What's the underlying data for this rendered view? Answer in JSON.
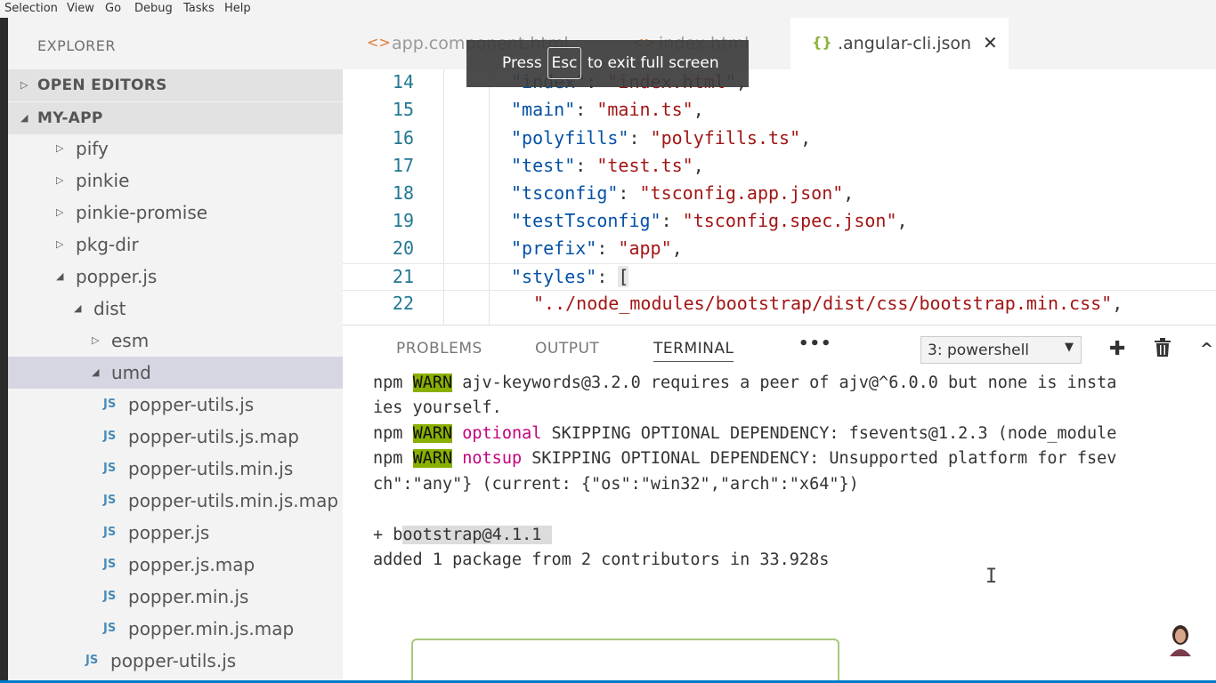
{
  "menubar": {
    "items": [
      "Selection",
      "View",
      "Go",
      "Debug",
      "Tasks",
      "Help"
    ]
  },
  "explorer": {
    "title": "EXPLORER",
    "open_editors": "OPEN EDITORS",
    "project": "MY-APP",
    "items": [
      {
        "name": "pify"
      },
      {
        "name": "pinkie"
      },
      {
        "name": "pinkie-promise"
      },
      {
        "name": "pkg-dir"
      },
      {
        "name": "popper.js"
      },
      {
        "name": "dist"
      },
      {
        "name": "esm"
      },
      {
        "name": "umd"
      },
      {
        "name": "popper-utils.js"
      },
      {
        "name": "popper-utils.js.map"
      },
      {
        "name": "popper-utils.min.js"
      },
      {
        "name": "popper-utils.min.js.map"
      },
      {
        "name": "popper.js"
      },
      {
        "name": "popper.js.map"
      },
      {
        "name": "popper.min.js"
      },
      {
        "name": "popper.min.js.map"
      },
      {
        "name": "popper-utils.js"
      }
    ],
    "js_badge": "JS"
  },
  "tabs": [
    {
      "icon": "<>",
      "label": "app.component.html"
    },
    {
      "icon": "<>",
      "label": "index.html"
    },
    {
      "icon": "{}",
      "label": ".angular-cli.json",
      "close": "✕"
    }
  ],
  "fullscreen_toast": {
    "press": "Press",
    "key": "Esc",
    "rest": "to exit full screen"
  },
  "code": {
    "lines": [
      {
        "num": "14",
        "key": "\"index\"",
        "sep": ": ",
        "value": "\"index.html\"",
        "end": ","
      },
      {
        "num": "15",
        "key": "\"main\"",
        "sep": ": ",
        "value": "\"main.ts\"",
        "end": ","
      },
      {
        "num": "16",
        "key": "\"polyfills\"",
        "sep": ": ",
        "value": "\"polyfills.ts\"",
        "end": ","
      },
      {
        "num": "17",
        "key": "\"test\"",
        "sep": ": ",
        "value": "\"test.ts\"",
        "end": ","
      },
      {
        "num": "18",
        "key": "\"tsconfig\"",
        "sep": ": ",
        "value": "\"tsconfig.app.json\"",
        "end": ","
      },
      {
        "num": "19",
        "key": "\"testTsconfig\"",
        "sep": ": ",
        "value": "\"tsconfig.spec.json\"",
        "end": ","
      },
      {
        "num": "20",
        "key": "\"prefix\"",
        "sep": ": ",
        "value": "\"app\"",
        "end": ","
      },
      {
        "num": "21",
        "key": "\"styles\"",
        "sep": ": ",
        "value": "",
        "end": "["
      },
      {
        "num": "22",
        "key": "",
        "sep": "",
        "value": "\"../node_modules/bootstrap/dist/css/bootstrap.min.css\"",
        "end": ","
      }
    ]
  },
  "panel": {
    "tabs": [
      "PROBLEMS",
      "OUTPUT",
      "TERMINAL"
    ],
    "more": "•••",
    "terminal_select": "3: powershell",
    "dropdown_arrow": "▼",
    "add": "✚",
    "trash": "🗑",
    "collapse": "^"
  },
  "terminal": {
    "l1_pre": "npm ",
    "warn": "WARN",
    "l1_post": " ajv-keywords@3.2.0 requires a peer of ajv@^6.0.0 but none is insta",
    "l2": "ies yourself.",
    "l3_tag": "optional",
    "l3_post": " SKIPPING OPTIONAL DEPENDENCY: fsevents@1.2.3 (node_module",
    "l4_tag": "notsup",
    "l4_post": " SKIPPING OPTIONAL DEPENDENCY: Unsupported platform for fsev",
    "l5": "ch\":\"any\"} (current: {\"os\":\"win32\",\"arch\":\"x64\"})",
    "l6_pre": "+ b",
    "l6_hl": "ootstrap@4.1.1 ",
    "l7": "added 1 package from 2 contributors in 33.928s"
  },
  "colors": {
    "accent": "#007acc",
    "warn_bg": "#89b000",
    "json_key": "#0451a5",
    "json_string": "#a31515"
  }
}
